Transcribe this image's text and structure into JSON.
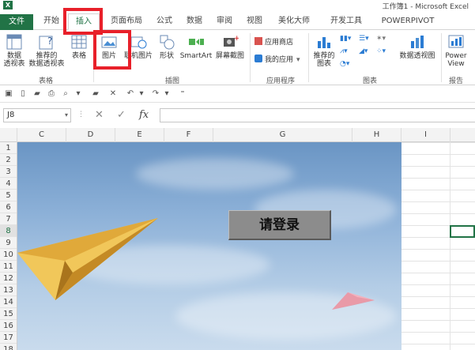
{
  "window": {
    "title": "工作簿1 - Microsoft Excel",
    "logo": "X"
  },
  "tabs": [
    {
      "label": "文件"
    },
    {
      "label": "开始"
    },
    {
      "label": "插入"
    },
    {
      "label": "页面布局"
    },
    {
      "label": "公式"
    },
    {
      "label": "数据"
    },
    {
      "label": "审阅"
    },
    {
      "label": "视图"
    },
    {
      "label": "美化大师"
    },
    {
      "label": "开发工具"
    },
    {
      "label": "POWERPIVOT"
    }
  ],
  "ribbon": {
    "pivot_table": "数据\n透视表",
    "recommended_pivot": "推荐的\n数据透视表",
    "table": "表格",
    "group_tables": "表格",
    "picture": "图片",
    "online_picture": "联机图片",
    "shapes": "形状",
    "smartart": "SmartArt",
    "screenshot": "屏幕截图",
    "group_illustrations": "插图",
    "app_store": "应用商店",
    "my_apps": "我的应用",
    "group_apps": "应用程序",
    "recommended_charts": "推荐的\n图表",
    "pivot_chart": "数据透视图",
    "group_charts": "图表",
    "power_view": "Power\nView",
    "group_reports": "报告"
  },
  "formula_bar": {
    "name_box": "J8",
    "formula": "",
    "fx": "fx"
  },
  "columns": [
    "C",
    "D",
    "E",
    "F",
    "G",
    "H",
    "I"
  ],
  "rows": [
    "1",
    "2",
    "3",
    "4",
    "5",
    "6",
    "7",
    "8",
    "9",
    "10",
    "11",
    "12",
    "13",
    "14",
    "15",
    "16",
    "17",
    "18"
  ],
  "selected_row": "8",
  "login_button": {
    "label": "请登录"
  },
  "colors": {
    "excel_green": "#217346",
    "highlight_red": "#e8202a",
    "plane_yellow": "#e8b84a",
    "plane_pink": "#e38a9a"
  }
}
